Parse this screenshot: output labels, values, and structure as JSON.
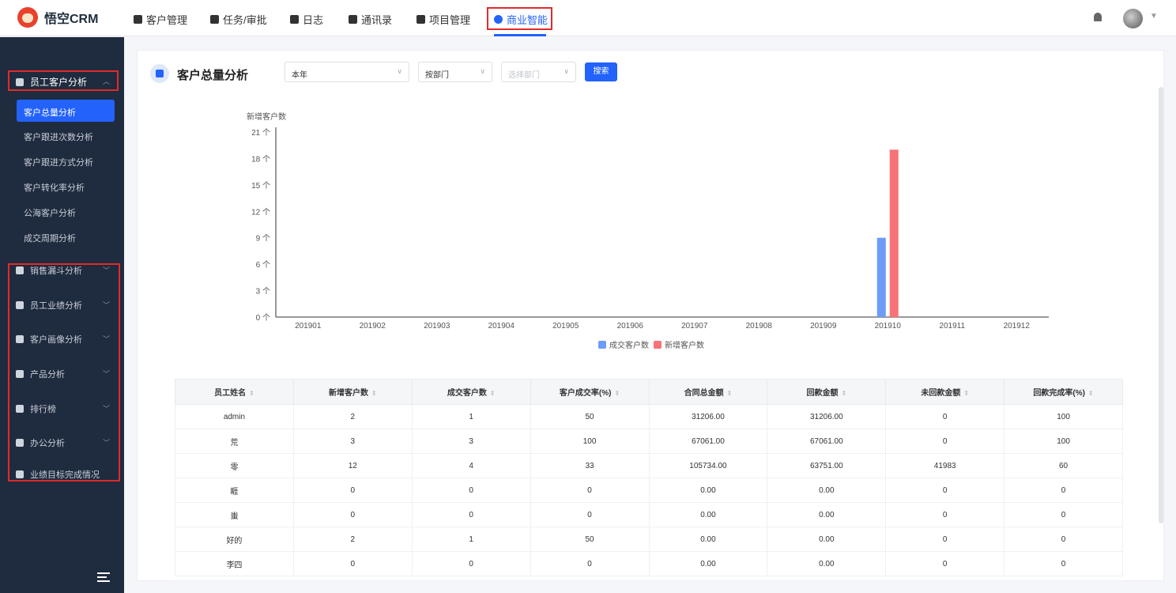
{
  "app": {
    "name": "悟空CRM"
  },
  "topnav": {
    "items": [
      {
        "label": "客户管理"
      },
      {
        "label": "任务/审批"
      },
      {
        "label": "日志"
      },
      {
        "label": "通讯录"
      },
      {
        "label": "项目管理"
      },
      {
        "label": "商业智能"
      }
    ],
    "accent": "#2362fb"
  },
  "sidebar": {
    "section": "员工客户分析",
    "sub_items": [
      "客户总量分析",
      "客户跟进次数分析",
      "客户跟进方式分析",
      "客户转化率分析",
      "公海客户分析",
      "成交周期分析"
    ],
    "groups": [
      "销售漏斗分析",
      "员工业绩分析",
      "客户画像分析",
      "产品分析",
      "排行榜",
      "办公分析",
      "业绩目标完成情况"
    ],
    "bg": "#1f2b3e"
  },
  "filters": {
    "title": "客户总量分析",
    "period": "本年",
    "by": "按部门",
    "dept_placeholder": "选择部门",
    "search_label": "搜索"
  },
  "chart_data": {
    "type": "bar",
    "ylabel": "新增客户数",
    "y_unit": "个",
    "ylim": [
      0,
      21
    ],
    "yticks": [
      0,
      3,
      6,
      9,
      12,
      15,
      18,
      21
    ],
    "categories": [
      "201901",
      "201902",
      "201903",
      "201904",
      "201905",
      "201906",
      "201907",
      "201908",
      "201909",
      "201910",
      "201911",
      "201912"
    ],
    "series": [
      {
        "name": "成交客户数",
        "color": "#6c9cf7",
        "values": [
          0,
          0,
          0,
          0,
          0,
          0,
          0,
          0,
          0,
          9,
          0,
          0
        ]
      },
      {
        "name": "新增客户数",
        "color": "#f77378",
        "values": [
          0,
          0,
          0,
          0,
          0,
          0,
          0,
          0,
          0,
          19,
          0,
          0
        ]
      }
    ],
    "legend_position": "bottom"
  },
  "table": {
    "columns": [
      "员工姓名",
      "新增客户数",
      "成交客户数",
      "客户成交率(%)",
      "合同总金额",
      "回款金额",
      "未回款金额",
      "回款完成率(%)"
    ],
    "rows": [
      [
        "admin",
        "2",
        "1",
        "50",
        "31206.00",
        "31206.00",
        "0",
        "100"
      ],
      [
        "荒",
        "3",
        "3",
        "100",
        "67061.00",
        "67061.00",
        "0",
        "100"
      ],
      [
        "零",
        "12",
        "4",
        "33",
        "105734.00",
        "63751.00",
        "41983",
        "60"
      ],
      [
        "睚",
        "0",
        "0",
        "0",
        "0.00",
        "0.00",
        "0",
        "0"
      ],
      [
        "蚩",
        "0",
        "0",
        "0",
        "0.00",
        "0.00",
        "0",
        "0"
      ],
      [
        "好的",
        "2",
        "1",
        "50",
        "0.00",
        "0.00",
        "0",
        "0"
      ],
      [
        "李四",
        "0",
        "0",
        "0",
        "0.00",
        "0.00",
        "0",
        "0"
      ]
    ]
  }
}
